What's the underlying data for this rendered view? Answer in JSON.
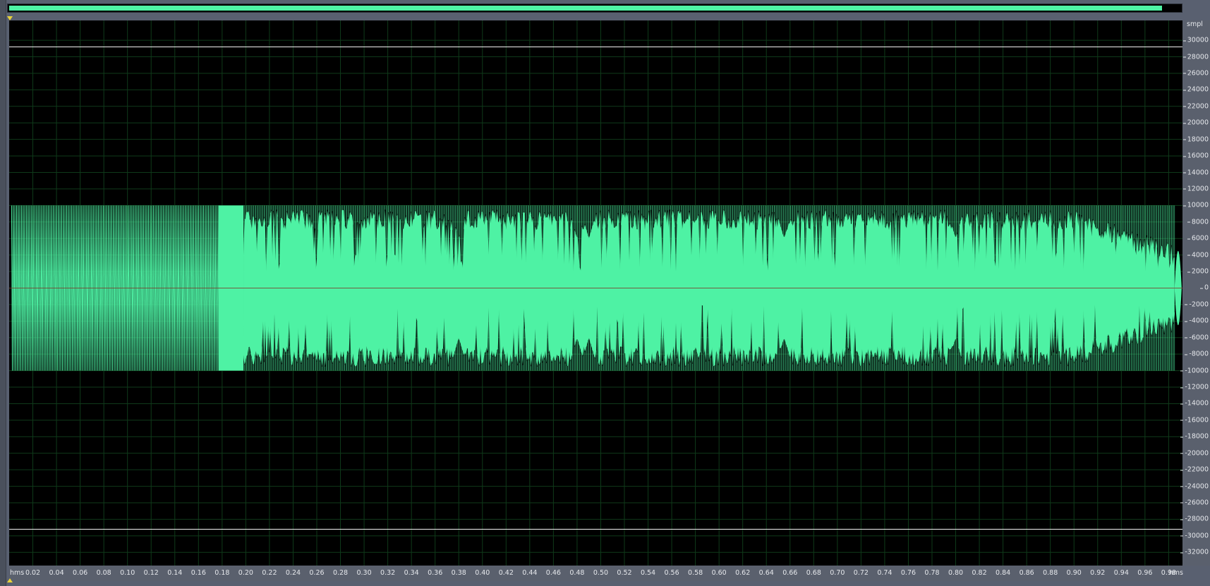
{
  "app": {
    "title": ""
  },
  "overview": {
    "visible_fraction": 0.99
  },
  "axes": {
    "y_unit": "smpl",
    "x_unit": "hms",
    "y_ticks": [
      "30000",
      "28000",
      "26000",
      "24000",
      "22000",
      "20000",
      "18000",
      "16000",
      "14000",
      "12000",
      "10000",
      "8000",
      "6000",
      "4000",
      "2000",
      "0",
      "-2000",
      "-4000",
      "-6000",
      "-8000",
      "-10000",
      "-12000",
      "-14000",
      "-16000",
      "-18000",
      "-20000",
      "-22000",
      "-24000",
      "-26000",
      "-28000",
      "-30000",
      "-32000"
    ],
    "x_ticks": [
      "0.02",
      "0.04",
      "0.06",
      "0.08",
      "0.10",
      "0.12",
      "0.14",
      "0.16",
      "0.18",
      "0.20",
      "0.22",
      "0.24",
      "0.26",
      "0.28",
      "0.30",
      "0.32",
      "0.34",
      "0.36",
      "0.38",
      "0.40",
      "0.42",
      "0.44",
      "0.46",
      "0.48",
      "0.50",
      "0.52",
      "0.54",
      "0.56",
      "0.58",
      "0.60",
      "0.62",
      "0.64",
      "0.66",
      "0.68",
      "0.70",
      "0.72",
      "0.74",
      "0.76",
      "0.78",
      "0.80",
      "0.82",
      "0.84",
      "0.86",
      "0.88",
      "0.90",
      "0.92",
      "0.94",
      "0.96",
      "0.98"
    ]
  },
  "colors": {
    "waveform": "#4ef2a4",
    "background": "#000000",
    "grid": "#0f3a1a",
    "zero_line": "#7a3a2a",
    "limit_line": "#f2f2f2",
    "panel": "#5a606d"
  },
  "chart_data": {
    "type": "line",
    "title": "",
    "xlabel": "hms",
    "ylabel": "smpl",
    "xlim": [
      0.0,
      0.9917
    ],
    "ylim": [
      -33600,
      32400
    ],
    "grid": true,
    "limit_lines": [
      29200,
      -29200
    ],
    "series": [
      {
        "values_description_points": {
          "x": [
            0.0,
            0.02,
            0.04,
            0.06,
            0.08,
            0.1,
            0.12,
            0.14,
            0.16,
            0.175,
            0.18,
            0.2,
            0.25,
            0.3,
            0.38,
            0.48,
            0.5,
            0.6,
            0.65,
            0.7,
            0.8,
            0.9,
            0.95,
            0.98,
            0.99
          ],
          "y_max": [
            10000,
            10000,
            10000,
            10000,
            10000,
            10000,
            10000,
            10000,
            10000,
            10000,
            10000,
            10000,
            10000,
            10000,
            10000,
            10000,
            10000,
            10000,
            10000,
            10000,
            10000,
            10000,
            10000,
            10000,
            9000
          ],
          "y_min": [
            -10000,
            -10000,
            -10000,
            -10000,
            -10000,
            -10000,
            -10000,
            -10000,
            -10000,
            -10000,
            -10000,
            -10000,
            -10000,
            -10000,
            -10000,
            -10000,
            -10000,
            -10000,
            -10000,
            -10000,
            -10000,
            -10000,
            -10000,
            -10000,
            -9000
          ]
        }
      }
    ]
  }
}
